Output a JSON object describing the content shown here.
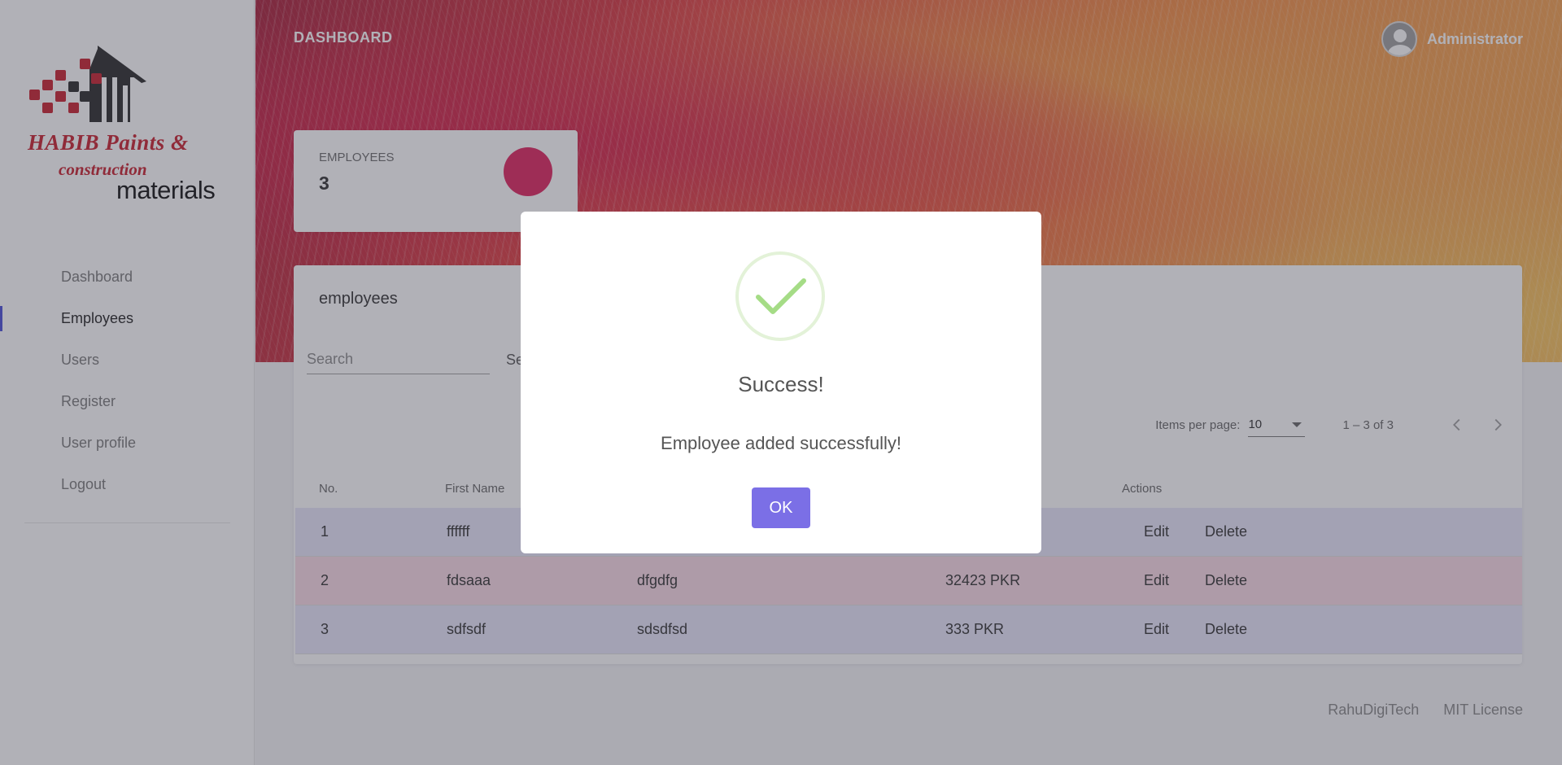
{
  "brand": {
    "line1": "HABIB Paints &",
    "line2": "construction",
    "line3": "materials"
  },
  "sidebar": {
    "items": [
      {
        "label": "Dashboard",
        "active": false
      },
      {
        "label": "Employees",
        "active": true
      },
      {
        "label": "Users",
        "active": false
      },
      {
        "label": "Register",
        "active": false
      },
      {
        "label": "User profile",
        "active": false
      },
      {
        "label": "Logout",
        "active": false
      }
    ]
  },
  "header": {
    "title": "DASHBOARD",
    "user_name": "Administrator"
  },
  "stats": {
    "label": "EMPLOYEES",
    "value": "3",
    "accent_color": "#e0245e"
  },
  "table_card": {
    "title": "employees",
    "search_placeholder": "Search",
    "search_button": "Se",
    "items_per_page_label": "Items per page:",
    "items_per_page_value": "10",
    "range_label": "1 – 3 of 3",
    "columns": [
      "No.",
      "First Name",
      "",
      "",
      "Actions"
    ],
    "rows": [
      {
        "no": "1",
        "first_name": "ffffff",
        "last_name": "",
        "salary": "",
        "edit": "Edit",
        "delete": "Delete"
      },
      {
        "no": "2",
        "first_name": "fdsaaa",
        "last_name": "dfgdfg",
        "salary": "32423 PKR",
        "edit": "Edit",
        "delete": "Delete"
      },
      {
        "no": "3",
        "first_name": "sdfsdf",
        "last_name": "sdsdfsd",
        "salary": "333 PKR",
        "edit": "Edit",
        "delete": "Delete"
      }
    ]
  },
  "footer": {
    "link1": "RahuDigiTech",
    "link2": "MIT License"
  },
  "modal": {
    "icon": "check-icon",
    "title": "Success!",
    "message": "Employee added successfully!",
    "ok_label": "OK",
    "ok_color": "#7b6fe6"
  }
}
